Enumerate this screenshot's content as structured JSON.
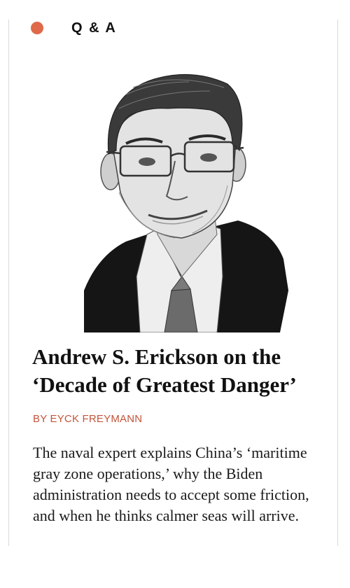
{
  "kicker": {
    "label": "Q & A",
    "dot_color": "#e0694a",
    "dot_icon": "circle-dot-icon"
  },
  "portrait": {
    "icon": "portrait-illustration"
  },
  "article": {
    "title": "Andrew S. Erickson on the ‘Decade of Greatest Danger’",
    "byline_prefix": "BY",
    "byline_author": "EYCK FREYMANN",
    "byline_color": "#c4553a",
    "dek": "The naval expert explains China’s ‘maritime gray zone operations,’ why the Biden administration needs to accept some friction, and when he thinks calmer seas will arrive."
  }
}
